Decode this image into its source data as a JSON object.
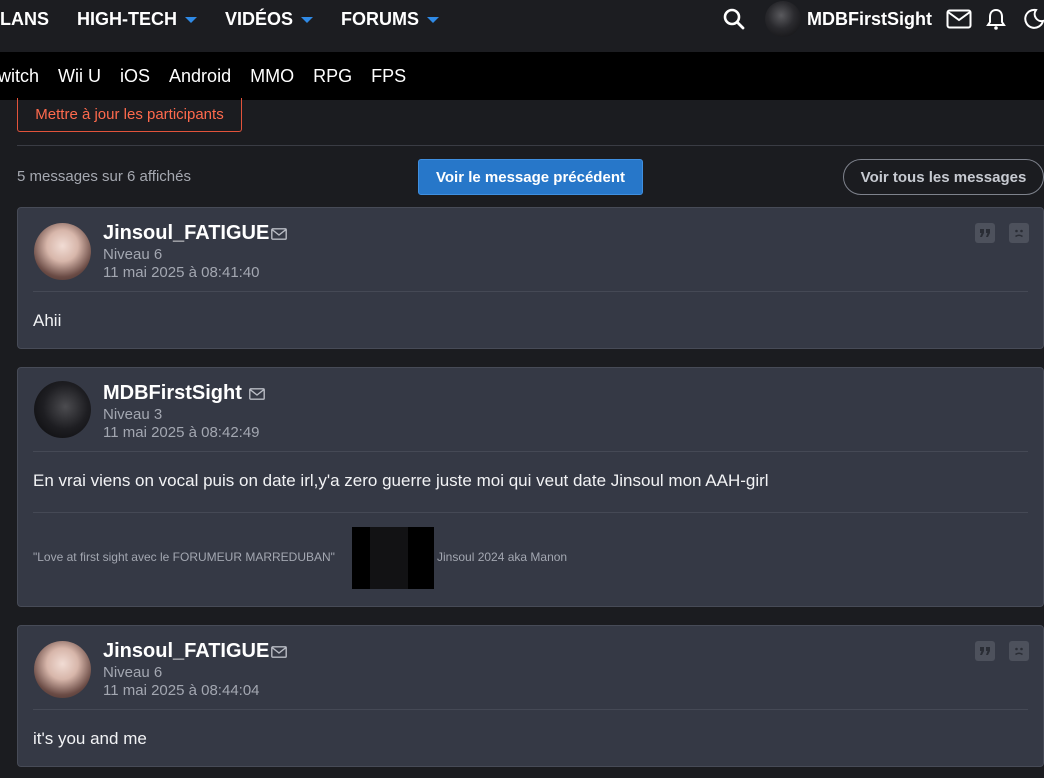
{
  "nav": {
    "items": [
      "LANS",
      "HIGH-TECH",
      "VIDÉOS",
      "FORUMS"
    ],
    "username": "MDBFirstSight"
  },
  "subnav": {
    "items": [
      "witch",
      "Wii U",
      "iOS",
      "Android",
      "MMO",
      "RPG",
      "FPS"
    ]
  },
  "topic": {
    "update_participants": "Mettre à jour les participants",
    "message_count": "5 messages sur 6 affichés",
    "prev_button": "Voir le message précédent",
    "all_button": "Voir tous les messages"
  },
  "posts": [
    {
      "author": "Jinsoul_FATIGUE",
      "level": "Niveau 6",
      "date": "11 mai 2025 à 08:41:40",
      "text": "Ahii"
    },
    {
      "author": "MDBFirstSight",
      "level": "Niveau 3",
      "date": "11 mai 2025 à 08:42:49",
      "text": "En vrai viens on vocal puis on date irl,y'a zero guerre juste moi qui veut date Jinsoul mon AAH-girl",
      "signature_left": "\"Love at first sight avec le FORUMEUR MARREDUBAN\"",
      "signature_right": "Jinsoul 2024 aka Manon"
    },
    {
      "author": "Jinsoul_FATIGUE",
      "level": "Niveau 6",
      "date": "11 mai 2025 à 08:44:04",
      "text": "it's you and me"
    }
  ],
  "icons": {
    "search": "search-icon",
    "mail": "mail-icon",
    "bell": "bell-icon",
    "theme": "moon-icon",
    "quote": "quote-icon",
    "report": "report-icon"
  },
  "colors": {
    "accent": "#2777c9",
    "danger": "#e2533b",
    "post_bg": "#353945"
  }
}
